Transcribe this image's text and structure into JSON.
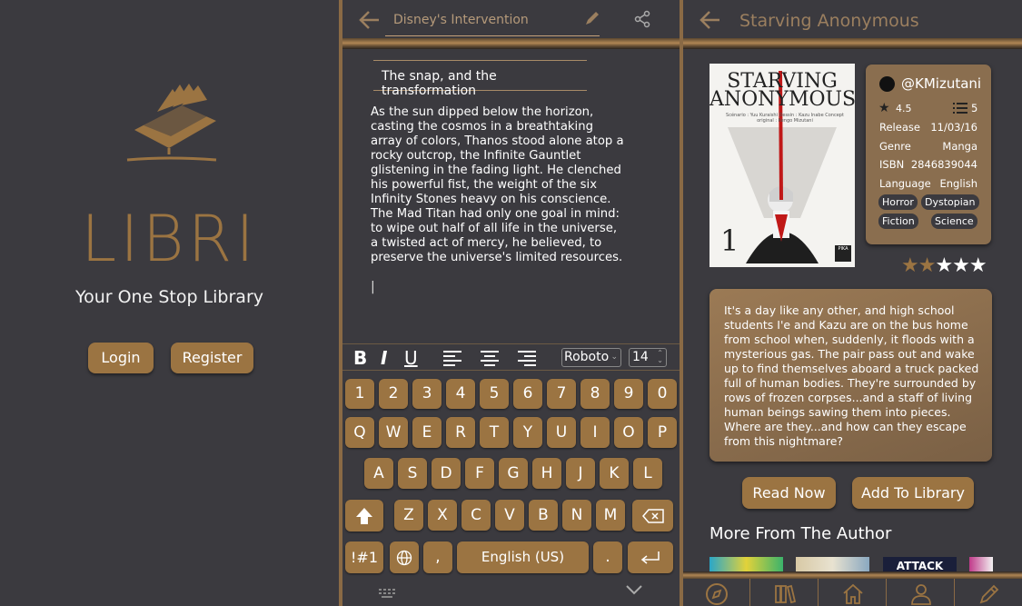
{
  "splash": {
    "brand": "LIBRI",
    "tagline": "Your One Stop Library",
    "login_label": "Login",
    "register_label": "Register"
  },
  "editor": {
    "doc_title": "Disney's Intervention",
    "chapter_title": "The snap, and the transformation",
    "body": "As the sun dipped below the horizon, casting the cosmos in a breathtaking array of colors, Thanos stood alone atop a rocky outcrop, the Infinite Gauntlet glistening in the fading light. He clenched his powerful fist, the weight of the six Infinity Stones heavy on his conscience. The Mad Titan had only one goal in mind: to wipe out half of all life in the universe, a twisted act of mercy, he believed, to preserve the universe's limited resources.",
    "cursor": "|",
    "format": {
      "bold": "B",
      "italic": "I",
      "underline": "U",
      "font": "Roboto",
      "size": "14"
    },
    "keyboard": {
      "numbers": [
        "1",
        "2",
        "3",
        "4",
        "5",
        "6",
        "7",
        "8",
        "9",
        "0"
      ],
      "row1": [
        "Q",
        "W",
        "E",
        "R",
        "T",
        "Y",
        "U",
        "I",
        "O",
        "P"
      ],
      "row2": [
        "A",
        "S",
        "D",
        "F",
        "G",
        "H",
        "J",
        "K",
        "L"
      ],
      "row3": [
        "Z",
        "X",
        "C",
        "V",
        "B",
        "N",
        "M"
      ],
      "symbols": "!#1",
      "comma": ",",
      "space": "English (US)",
      "period": "."
    }
  },
  "book": {
    "title": "Starving Anonymous",
    "cover": {
      "title_line1": "STARVING",
      "title_line2": "ANONYMOUS",
      "credits": "Scénario : Yuu Kuraishi   Dessin : Kazu Inabe   Concept original : Kengo Mizutani",
      "volume": "1",
      "publisher": "PIKA"
    },
    "author_handle": "@KMizutani",
    "rating": "4.5",
    "list_count": "5",
    "details": [
      {
        "label": "Release",
        "value": "11/03/16"
      },
      {
        "label": "Genre",
        "value": "Manga"
      },
      {
        "label": "ISBN",
        "value": "2846839044"
      },
      {
        "label": "Language",
        "value": "English"
      }
    ],
    "tags": [
      "Horror",
      "Dystopian",
      "Fiction",
      "Science"
    ],
    "stars": {
      "filled": "★★",
      "empty": "★★★"
    },
    "star_rating": 2,
    "synopsis": "It's a day like any other, and high school students I'e and Kazu are on the bus home from school when, suddenly, it floods with a mysterious gas. The pair pass out and wake up to find themselves aboard a truck packed full of human bodies. They're surrounded by rows of frozen corpses...and a staff of living human beings sawing them into pieces. Where are they...and how can they escape from this nightmare?",
    "read_label": "Read Now",
    "add_label": "Add To Library",
    "more_heading": "More From The Author",
    "thumb_text": [
      "ATTACK"
    ],
    "colors": {
      "accent": "#9b7442",
      "background": "#3b3a3f",
      "card": "#8a6e4f",
      "star_filled": "#9b7442"
    }
  },
  "nav": [
    "compass-icon",
    "books-icon",
    "home-icon",
    "user-icon",
    "pencil-icon"
  ]
}
